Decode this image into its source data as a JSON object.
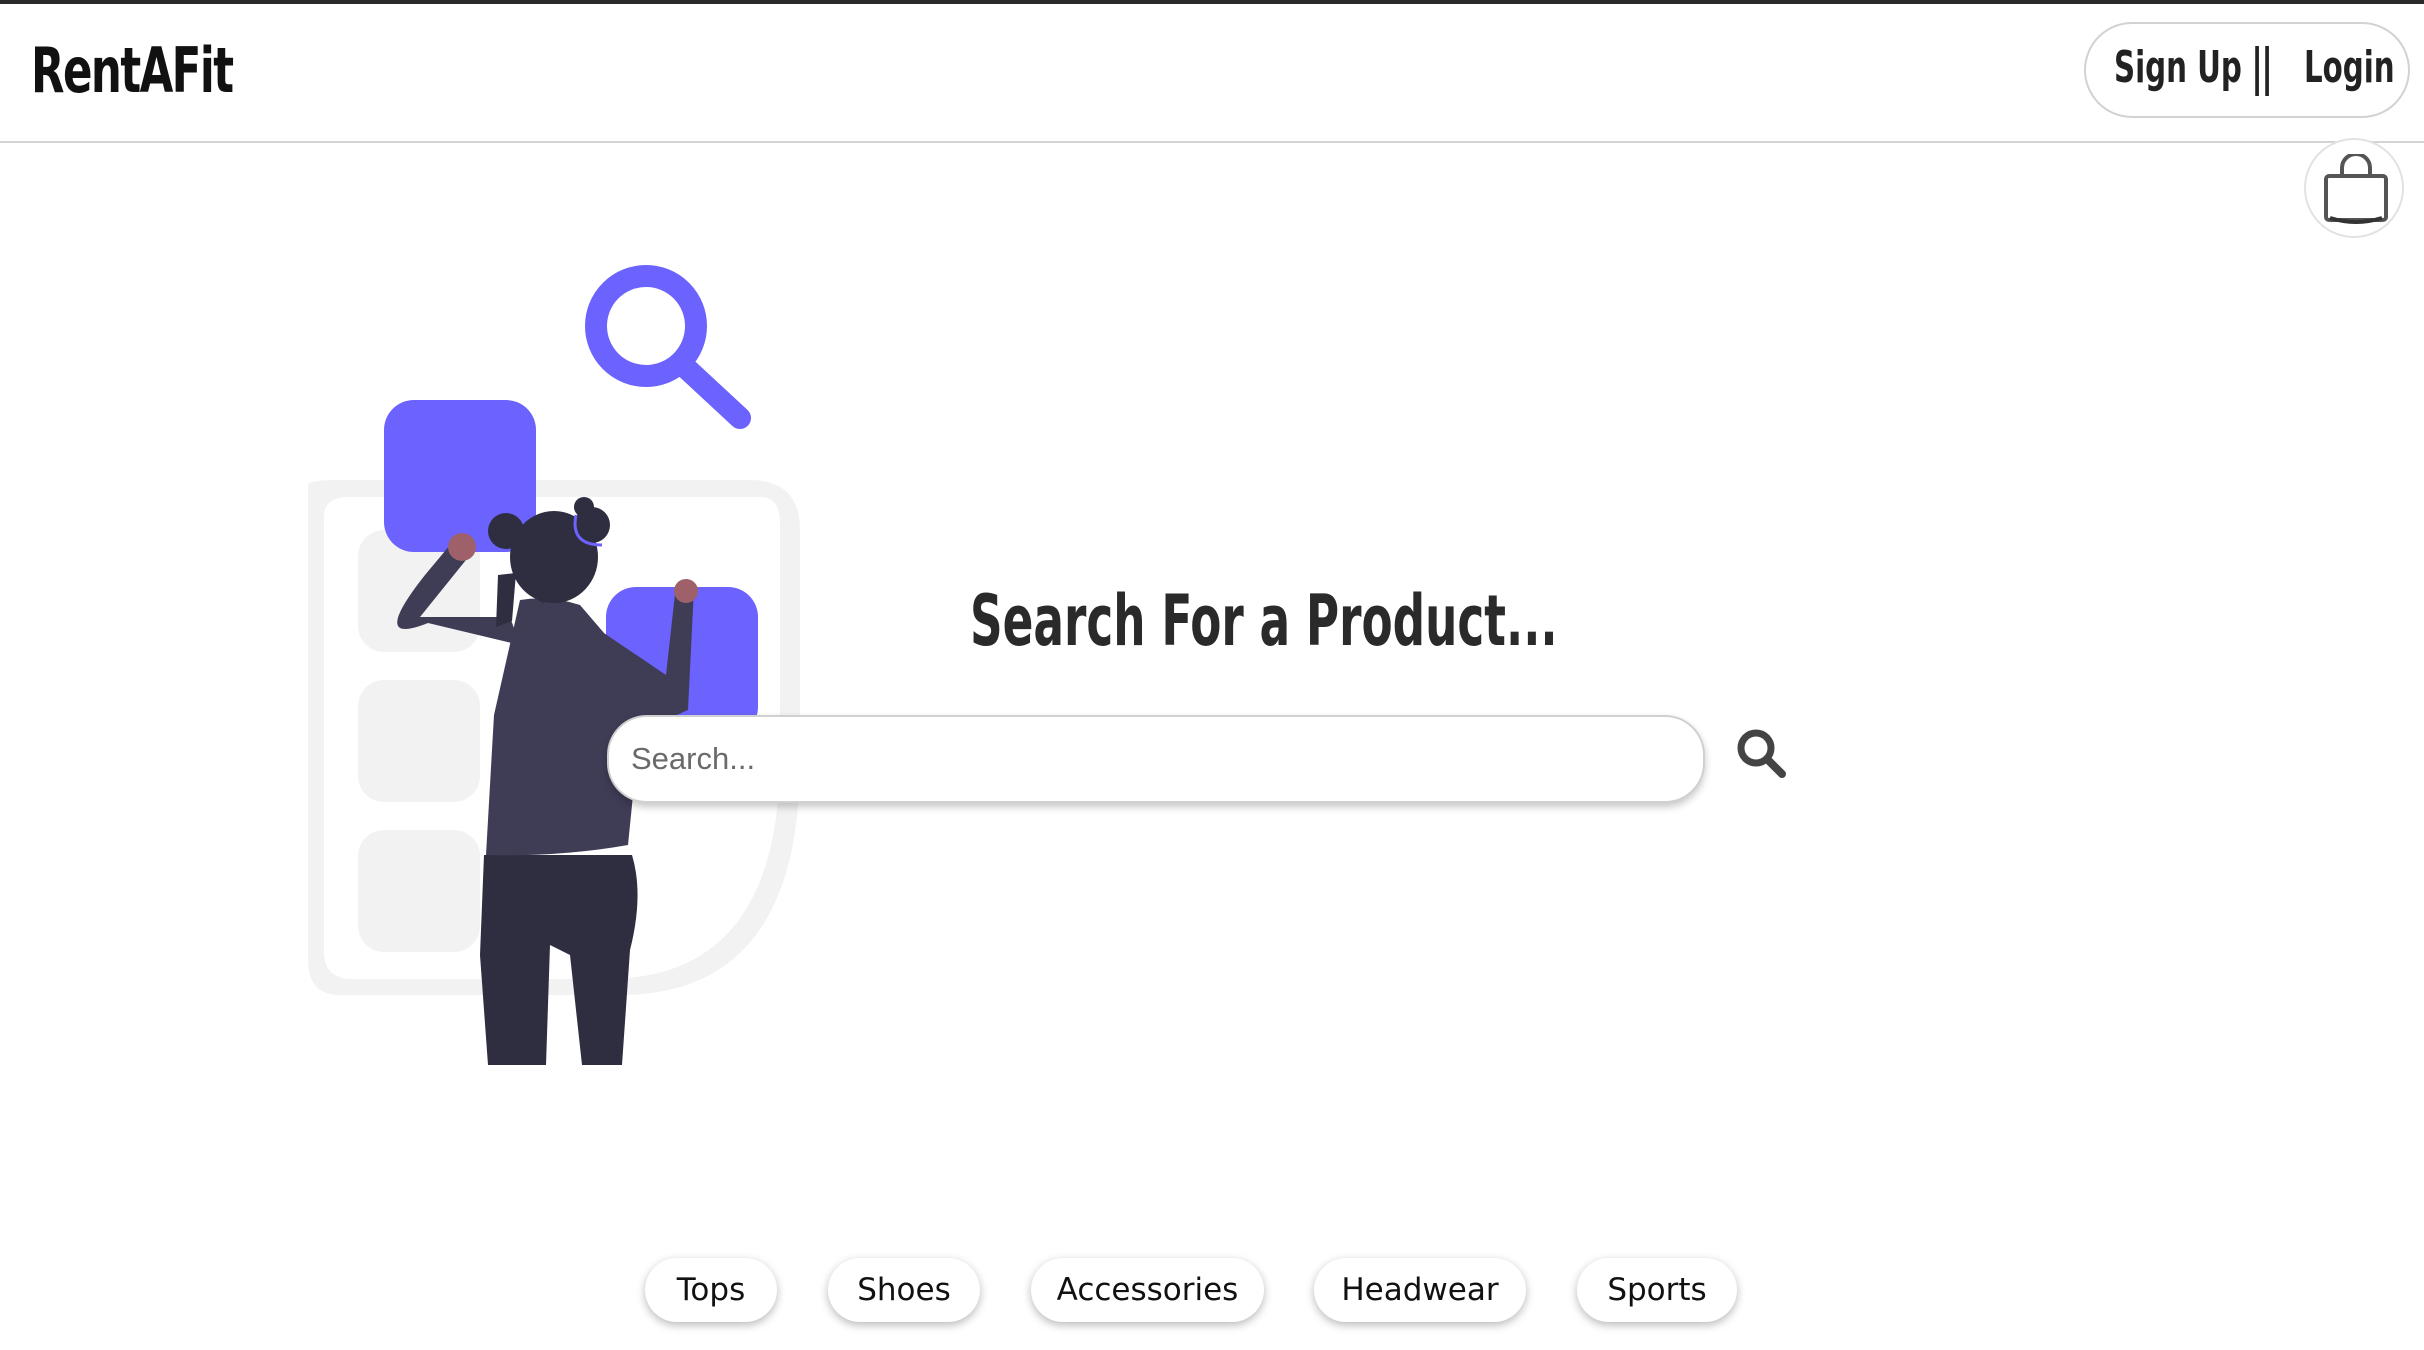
{
  "header": {
    "logo": "RentAFit",
    "signup_label": "Sign Up",
    "separator": "||",
    "login_label": "Login",
    "cart_icon": "shopping-bag-icon"
  },
  "main": {
    "heading": "Search For a Product...",
    "search": {
      "placeholder": "Search...",
      "value": "",
      "button_icon": "search-icon"
    },
    "illustration": "person-searching-illustration"
  },
  "categories": [
    "Tops",
    "Shoes",
    "Accessories",
    "Headwear",
    "Sports"
  ],
  "colors": {
    "accent": "#6c63ff",
    "text": "#222222",
    "figure_dark": "#2f2e41",
    "skin": "#9e616a",
    "card_bg": "#f2f2f2"
  }
}
